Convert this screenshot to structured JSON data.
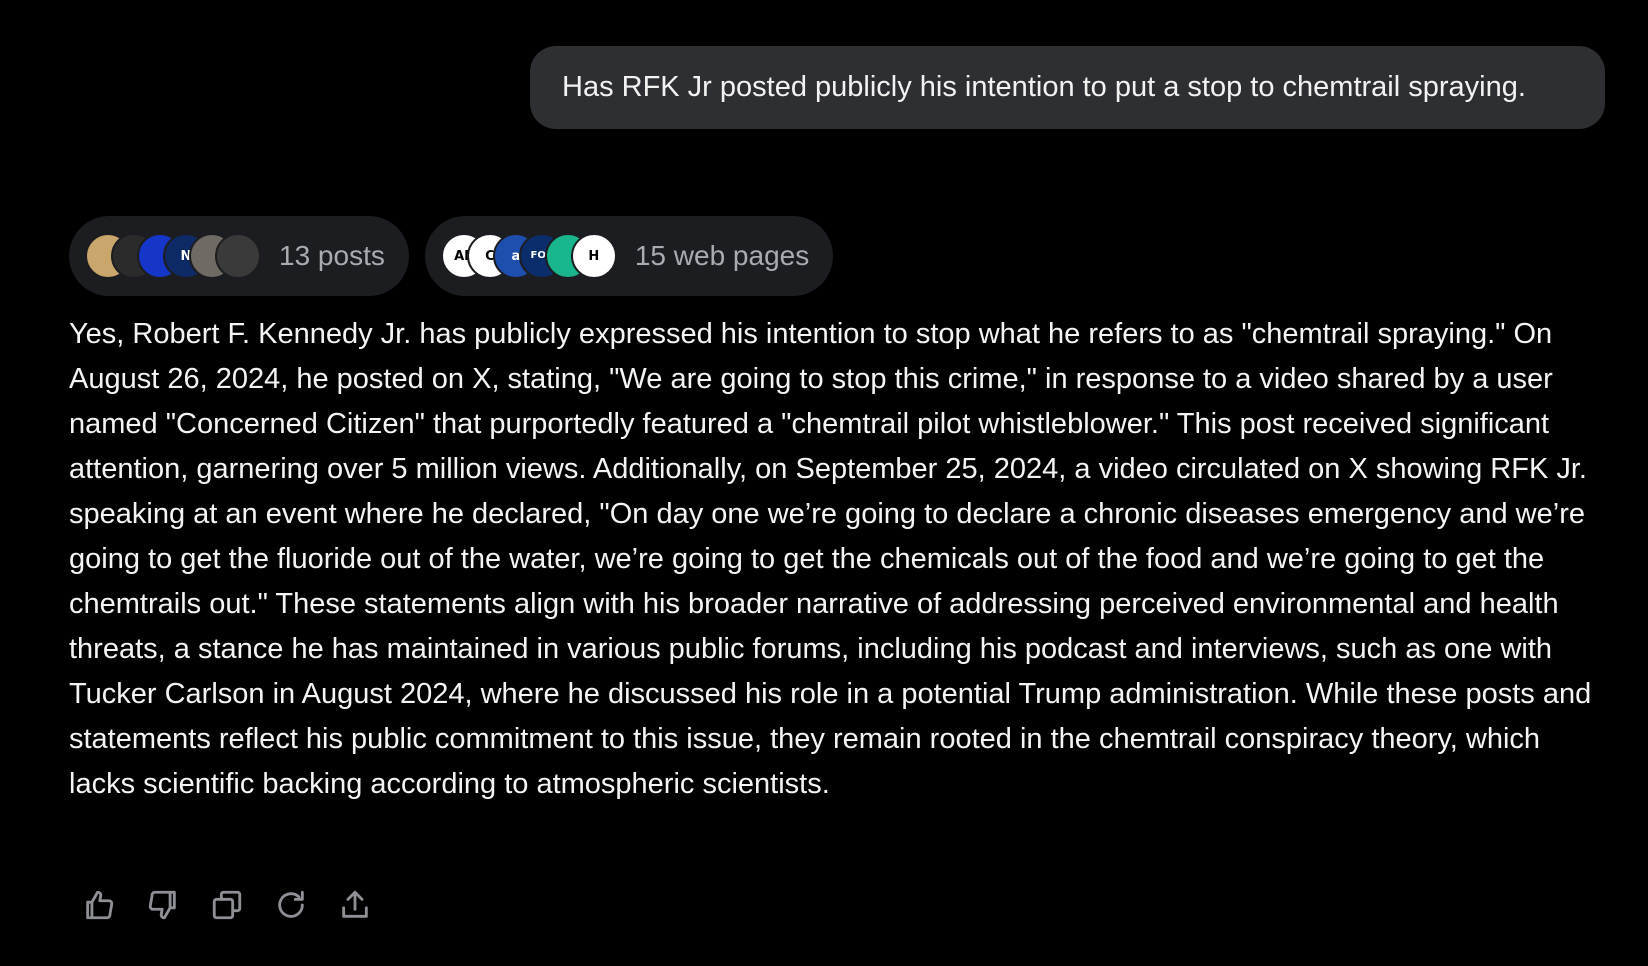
{
  "user_message": "Has RFK Jr posted publicly his intention to put a stop to chemtrail spraying.",
  "sources": {
    "posts": {
      "label": "13 posts",
      "avatars": [
        {
          "icon": "landscape-avatar-icon",
          "text": "",
          "bg": "#c9a66b",
          "fg": "#ffffff"
        },
        {
          "icon": "dark-figure-avatar-icon",
          "text": "",
          "bg": "#2b2b2b",
          "fg": "#888888"
        },
        {
          "icon": "blue-orb-avatar-icon",
          "text": "",
          "bg": "#1536c9",
          "fg": "#7fa2ff"
        },
        {
          "icon": "news-tile-avatar-icon",
          "text": "N",
          "bg": "#0d2a66",
          "fg": "#ffffff"
        },
        {
          "icon": "portrait-avatar-icon",
          "text": "",
          "bg": "#6f6a63",
          "fg": "#d8d0c4"
        },
        {
          "icon": "winning-avatar-icon",
          "text": "",
          "bg": "#3a3a3a",
          "fg": "#eeeeee"
        }
      ]
    },
    "web": {
      "label": "15 web pages",
      "avatars": [
        {
          "icon": "ap-logo-icon",
          "text": "AP",
          "bg": "#ffffff",
          "fg": "#000000"
        },
        {
          "icon": "c-logo-icon",
          "text": "C",
          "bg": "#ffffff",
          "fg": "#000000"
        },
        {
          "icon": "a-logo-icon",
          "text": "a",
          "bg": "#1f4fae",
          "fg": "#ffffff"
        },
        {
          "icon": "fox-news-logo-icon",
          "text": "FOX",
          "bg": "#0c2d6b",
          "fg": "#ffffff"
        },
        {
          "icon": "green-logo-icon",
          "text": "",
          "bg": "#19b58c",
          "fg": "#ffffff"
        },
        {
          "icon": "hill-logo-icon",
          "text": "H",
          "bg": "#ffffff",
          "fg": "#000000"
        }
      ]
    }
  },
  "answer": "Yes, Robert F. Kennedy Jr. has publicly expressed his intention to stop what he refers to as \"chemtrail spraying.\" On August 26, 2024, he posted on X, stating, \"We are going to stop this crime,\" in response to a video shared by a user named \"Concerned Citizen\" that purportedly featured a \"chemtrail pilot whistleblower.\" This post received significant attention, garnering over 5 million views. Additionally, on September 25, 2024, a video circulated on X showing RFK Jr. speaking at an event where he declared, \"On day one we’re going to declare a chronic diseases emergency and we’re going to get the fluoride out of the water, we’re going to get the chemicals out of the food and we’re going to get the chemtrails out.\" These statements align with his broader narrative of addressing perceived environmental and health threats, a stance he has maintained in various public forums, including his podcast and interviews, such as one with Tucker Carlson in August 2024, where he discussed his role in a potential Trump administration. While these posts and statements reflect his public commitment to this issue, they remain rooted in the chemtrail conspiracy theory, which lacks scientific backing according to atmospheric scientists.",
  "actions": [
    {
      "icon": "thumbs-up-icon"
    },
    {
      "icon": "thumbs-down-icon"
    },
    {
      "icon": "copy-icon"
    },
    {
      "icon": "regenerate-icon"
    },
    {
      "icon": "share-icon"
    }
  ]
}
